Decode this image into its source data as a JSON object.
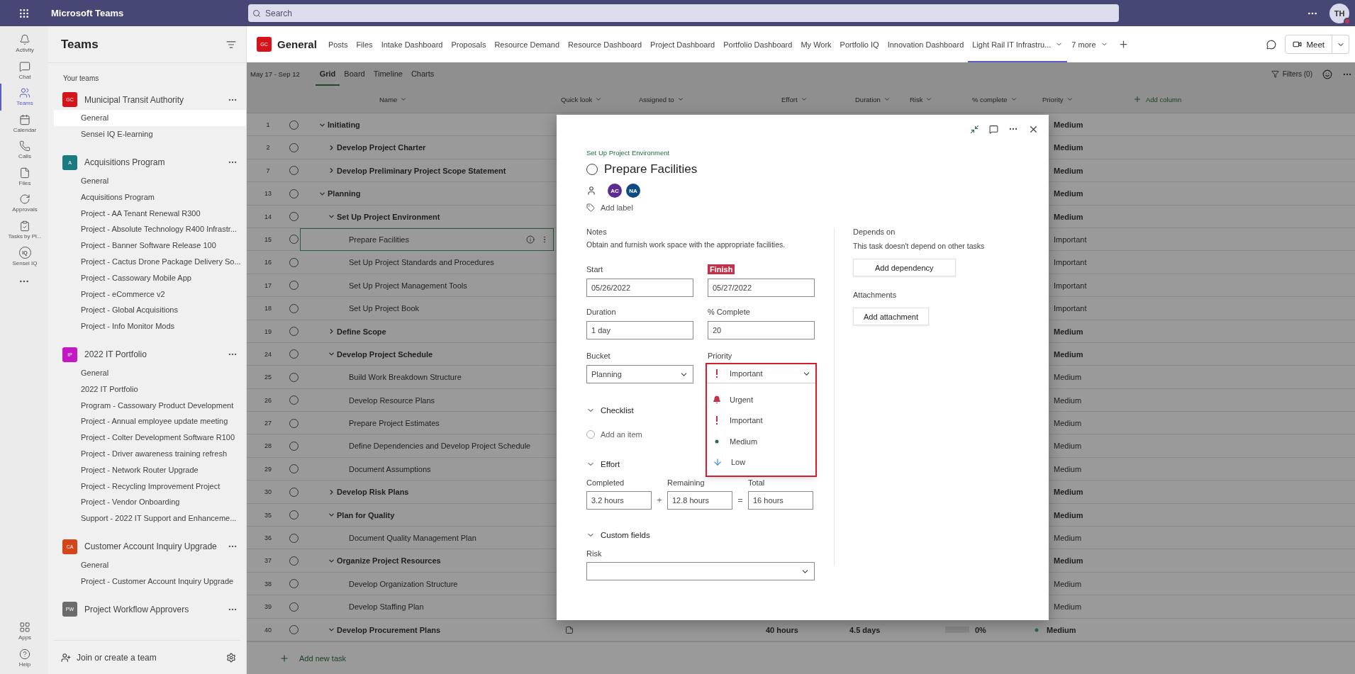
{
  "app_bar": {
    "title": "Microsoft Teams",
    "search": {
      "placeholder": "Search"
    },
    "avatar": {
      "initials": "TH"
    }
  },
  "rail": {
    "items": [
      {
        "label": "Activity",
        "selected": false
      },
      {
        "label": "Chat",
        "selected": false
      },
      {
        "label": "Teams",
        "selected": true
      },
      {
        "label": "Calendar",
        "selected": false
      },
      {
        "label": "Calls",
        "selected": false
      },
      {
        "label": "Files",
        "selected": false
      },
      {
        "label": "Approvals",
        "selected": false
      },
      {
        "label": "Tasks by Pl...",
        "selected": false
      },
      {
        "label": "Sensei IQ",
        "badge": "IQ",
        "selected": false
      }
    ],
    "bottom": [
      {
        "label": "Apps"
      },
      {
        "label": "Help"
      }
    ]
  },
  "teams_panel": {
    "title": "Teams",
    "section": "Your teams",
    "footer": "Join or create a team",
    "teams": [
      {
        "initials": "GC",
        "color": "#d4131b",
        "name": "Municipal Transit Authority",
        "channels": [
          {
            "name": "General",
            "selected": true
          },
          {
            "name": "Sensei IQ E-learning",
            "selected": false
          }
        ]
      },
      {
        "initials": "A",
        "color": "#1b7b80",
        "name": "Acquisitions Program",
        "channels": [
          {
            "name": "General",
            "selected": false
          },
          {
            "name": "Acquisitions Program",
            "selected": false
          },
          {
            "name": "Project - AA Tenant Renewal R300",
            "selected": false
          },
          {
            "name": "Project - Absolute Technology R400 Infrastr...",
            "selected": false
          },
          {
            "name": "Project - Banner Software Release 100",
            "selected": false
          },
          {
            "name": "Project - Cactus Drone Package Delivery So...",
            "selected": false
          },
          {
            "name": "Project - Cassowary Mobile App",
            "selected": false
          },
          {
            "name": "Project - eCommerce v2",
            "selected": false
          },
          {
            "name": "Project - Global Acquisitions",
            "selected": false
          },
          {
            "name": "Project - Info Monitor Mods",
            "selected": false
          }
        ]
      },
      {
        "initials": "IP",
        "color": "#c418c4",
        "name": "2022 IT Portfolio",
        "channels": [
          {
            "name": "General",
            "selected": false
          },
          {
            "name": "2022 IT Portfolio",
            "selected": false
          },
          {
            "name": "Program - Cassowary Product Development",
            "selected": false
          },
          {
            "name": "Project - Annual employee update meeting",
            "selected": false
          },
          {
            "name": "Project - Colter Development Software R100",
            "selected": false
          },
          {
            "name": "Project - Driver awareness training refresh",
            "selected": false
          },
          {
            "name": "Project - Network Router Upgrade",
            "selected": false
          },
          {
            "name": "Project - Recycling Improvement Project",
            "selected": false
          },
          {
            "name": "Project - Vendor Onboarding",
            "selected": false
          },
          {
            "name": "Support - 2022 IT Support and Enhanceme...",
            "selected": false
          }
        ]
      },
      {
        "initials": "CA",
        "color": "#d4461a",
        "name": "Customer Account Inquiry Upgrade",
        "channels": [
          {
            "name": "General",
            "selected": false
          },
          {
            "name": "Project - Customer Account Inquiry Upgrade",
            "selected": false
          }
        ]
      },
      {
        "initials": "PW",
        "color": "#6b6b6b",
        "name": "Project Workflow Approvers"
      }
    ]
  },
  "channel": {
    "initials": "GC",
    "color": "#d4131b",
    "name": "General",
    "tabs": [
      {
        "label": "Posts",
        "selected": false
      },
      {
        "label": "Files",
        "selected": false
      },
      {
        "label": "Intake Dashboard",
        "selected": false
      },
      {
        "label": "Proposals",
        "selected": false
      },
      {
        "label": "Resource Demand",
        "selected": false
      },
      {
        "label": "Resource Dashboard",
        "selected": false
      },
      {
        "label": "Project Dashboard",
        "selected": false
      },
      {
        "label": "Portfolio Dashboard",
        "selected": false
      },
      {
        "label": "My Work",
        "selected": false
      },
      {
        "label": "Portfolio IQ",
        "selected": false
      },
      {
        "label": "Innovation Dashboard",
        "selected": false
      },
      {
        "label": "Light Rail IT Infrastru...",
        "selected": true
      }
    ],
    "more_tabs": "7 more",
    "meet": "Meet"
  },
  "toolbar": {
    "date_range": "May 17 - Sep 12",
    "views": [
      {
        "label": "Grid",
        "selected": true
      },
      {
        "label": "Board",
        "selected": false
      },
      {
        "label": "Timeline",
        "selected": false
      },
      {
        "label": "Charts",
        "selected": false
      }
    ],
    "filters": "Filters (0)"
  },
  "grid": {
    "columns": [
      "Name",
      "Quick look",
      "Assigned to",
      "Effort",
      "Duration",
      "Risk",
      "% complete",
      "Priority"
    ],
    "add_column": "Add column",
    "add_task": "Add new task",
    "rows": [
      {
        "number": "1",
        "name": "Initiating",
        "kind": "summary",
        "expanded": true,
        "selected": false,
        "priority": "Medium",
        "children": [
          {
            "number": "2",
            "name": "Develop Project Charter",
            "kind": "summary",
            "expanded": false,
            "selected": false,
            "priority": "Medium"
          },
          {
            "number": "7",
            "name": "Develop Preliminary Project Scope Statement",
            "kind": "summary",
            "expanded": false,
            "selected": false,
            "priority": "Medium"
          }
        ]
      },
      {
        "number": "13",
        "name": "Planning",
        "kind": "summary",
        "expanded": true,
        "selected": false,
        "priority": "Medium",
        "children": [
          {
            "number": "14",
            "name": "Set Up Project Environment",
            "kind": "summary",
            "expanded": true,
            "selected": false,
            "priority": "Medium",
            "children": [
              {
                "number": "15",
                "name": "Prepare Facilities",
                "kind": "task",
                "selected": true,
                "priority": "Important"
              },
              {
                "number": "16",
                "name": "Set Up Project Standards and Procedures",
                "kind": "task",
                "selected": false,
                "priority": "Important"
              },
              {
                "number": "17",
                "name": "Set Up Project Management Tools",
                "kind": "task",
                "selected": false,
                "priority": "Important"
              },
              {
                "number": "18",
                "name": "Set Up Project Book",
                "kind": "task",
                "selected": false,
                "priority": "Important"
              }
            ]
          },
          {
            "number": "19",
            "name": "Define Scope",
            "kind": "summary",
            "expanded": false,
            "selected": false,
            "priority": "Medium"
          },
          {
            "number": "24",
            "name": "Develop Project Schedule",
            "kind": "summary",
            "expanded": true,
            "selected": false,
            "priority": "Medium",
            "children": [
              {
                "number": "25",
                "name": "Build Work Breakdown Structure",
                "kind": "task",
                "selected": false,
                "priority": "Medium"
              },
              {
                "number": "26",
                "name": "Develop Resource Plans",
                "kind": "task",
                "selected": false,
                "priority": "Medium"
              },
              {
                "number": "27",
                "name": "Prepare Project Estimates",
                "kind": "task",
                "selected": false,
                "priority": "Medium"
              },
              {
                "number": "28",
                "name": "Define Dependencies and Develop Project Schedule",
                "kind": "task",
                "selected": false,
                "priority": "Medium"
              },
              {
                "number": "29",
                "name": "Document Assumptions",
                "kind": "task",
                "selected": false,
                "priority": "Medium"
              }
            ]
          },
          {
            "number": "30",
            "name": "Develop Risk Plans",
            "kind": "summary",
            "expanded": false,
            "selected": false,
            "priority": "Medium"
          },
          {
            "number": "35",
            "name": "Plan for Quality",
            "kind": "summary",
            "expanded": true,
            "selected": false,
            "priority": "Medium",
            "children": [
              {
                "number": "36",
                "name": "Document Quality Management Plan",
                "kind": "task",
                "selected": false,
                "priority": "Medium"
              }
            ]
          },
          {
            "number": "37",
            "name": "Organize Project Resources",
            "kind": "summary",
            "expanded": true,
            "selected": false,
            "priority": "Medium",
            "children": [
              {
                "number": "38",
                "name": "Develop Organization Structure",
                "kind": "task",
                "selected": false,
                "priority": "Medium"
              },
              {
                "number": "39",
                "name": "Develop Staffing Plan",
                "kind": "task",
                "selected": false,
                "priority": "Medium"
              }
            ]
          },
          {
            "number": "40",
            "name": "Develop Procurement Plans",
            "kind": "summary",
            "expanded": true,
            "selected": false,
            "priority": "Medium",
            "details": {
              "effort": "40 hours",
              "duration": "4.5 days",
              "complete": "0%",
              "level": 0,
              "priority_icon": {
                "kind": "medium"
              }
            }
          }
        ]
      }
    ]
  },
  "task_dialog": {
    "bucket_path": "Set Up Project Environment",
    "title": "Prepare Facilities",
    "completed": false,
    "assignees": [
      {
        "initials": "AC",
        "color": "#5c2d91"
      },
      {
        "initials": "NA",
        "color": "#0f4a85"
      }
    ],
    "add_label": "Add label",
    "notes": {
      "label": "Notes",
      "text": "Obtain and furnish work space with the appropriate facilities."
    },
    "fields": [
      {
        "label": "Start",
        "value": "05/26/2022",
        "highlighted": false
      },
      {
        "label": "Finish",
        "value": "05/27/2022",
        "highlighted": true
      },
      {
        "label": "Duration",
        "value": "1 day",
        "highlighted": false
      },
      {
        "label": "% Complete",
        "value": "20",
        "highlighted": false
      }
    ],
    "bucket": {
      "label": "Bucket",
      "value": "Planning"
    },
    "priority": {
      "label": "Priority",
      "value": {
        "label": "Important",
        "kind": "important"
      },
      "expanded": true,
      "highlighted": true,
      "options": [
        {
          "label": "Urgent",
          "kind": "urgent"
        },
        {
          "label": "Important",
          "kind": "important"
        },
        {
          "label": "Medium",
          "kind": "medium"
        },
        {
          "label": "Low",
          "kind": "low"
        }
      ]
    },
    "checklist": {
      "label": "Checklist",
      "expanded": true,
      "placeholder": "Add an item"
    },
    "effort": {
      "label": "Effort",
      "expanded": true,
      "completed": {
        "label": "Completed",
        "value": "3.2 hours"
      },
      "plus": "+",
      "remaining": {
        "label": "Remaining",
        "value": "12.8 hours"
      },
      "equals": "=",
      "total": {
        "label": "Total",
        "value": "16 hours"
      }
    },
    "custom_fields": {
      "label": "Custom fields",
      "expanded": true,
      "risk": {
        "label": "Risk"
      }
    },
    "depends_on": {
      "label": "Depends on",
      "text": "This task doesn't depend on other tasks",
      "button": "Add dependency"
    },
    "attachments": {
      "label": "Attachments",
      "button": "Add attachment"
    }
  }
}
